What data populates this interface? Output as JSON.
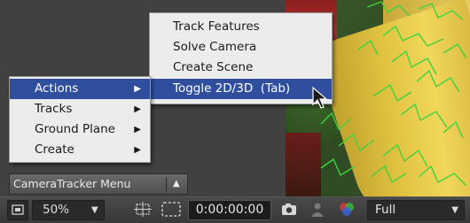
{
  "context_menu": {
    "items": [
      {
        "label": "Actions",
        "has_submenu": true,
        "highlighted": false
      },
      {
        "label": "Tracks",
        "has_submenu": true,
        "highlighted": false
      },
      {
        "label": "Ground Plane",
        "has_submenu": true,
        "highlighted": false
      },
      {
        "label": "Create",
        "has_submenu": true,
        "highlighted": false
      }
    ],
    "arrow_glyph": "▶"
  },
  "actions_submenu": {
    "items": [
      {
        "label": "Track Features"
      },
      {
        "label": "Solve Camera"
      },
      {
        "label": "Create Scene"
      },
      {
        "label": "Toggle 2D/3D  (Tab)",
        "highlighted": true
      }
    ]
  },
  "camera_tracker_menu": {
    "label": "CameraTracker Menu",
    "button_glyph": "▲"
  },
  "toolbar": {
    "zoom": "50%",
    "timecode": "0:00:00:00",
    "quality": "Full",
    "dropdown_glyph": "▼"
  },
  "colors": {
    "menu_bg": "#ececec",
    "highlight": "#2f4f9e",
    "track_lines": "#3fd23f"
  }
}
